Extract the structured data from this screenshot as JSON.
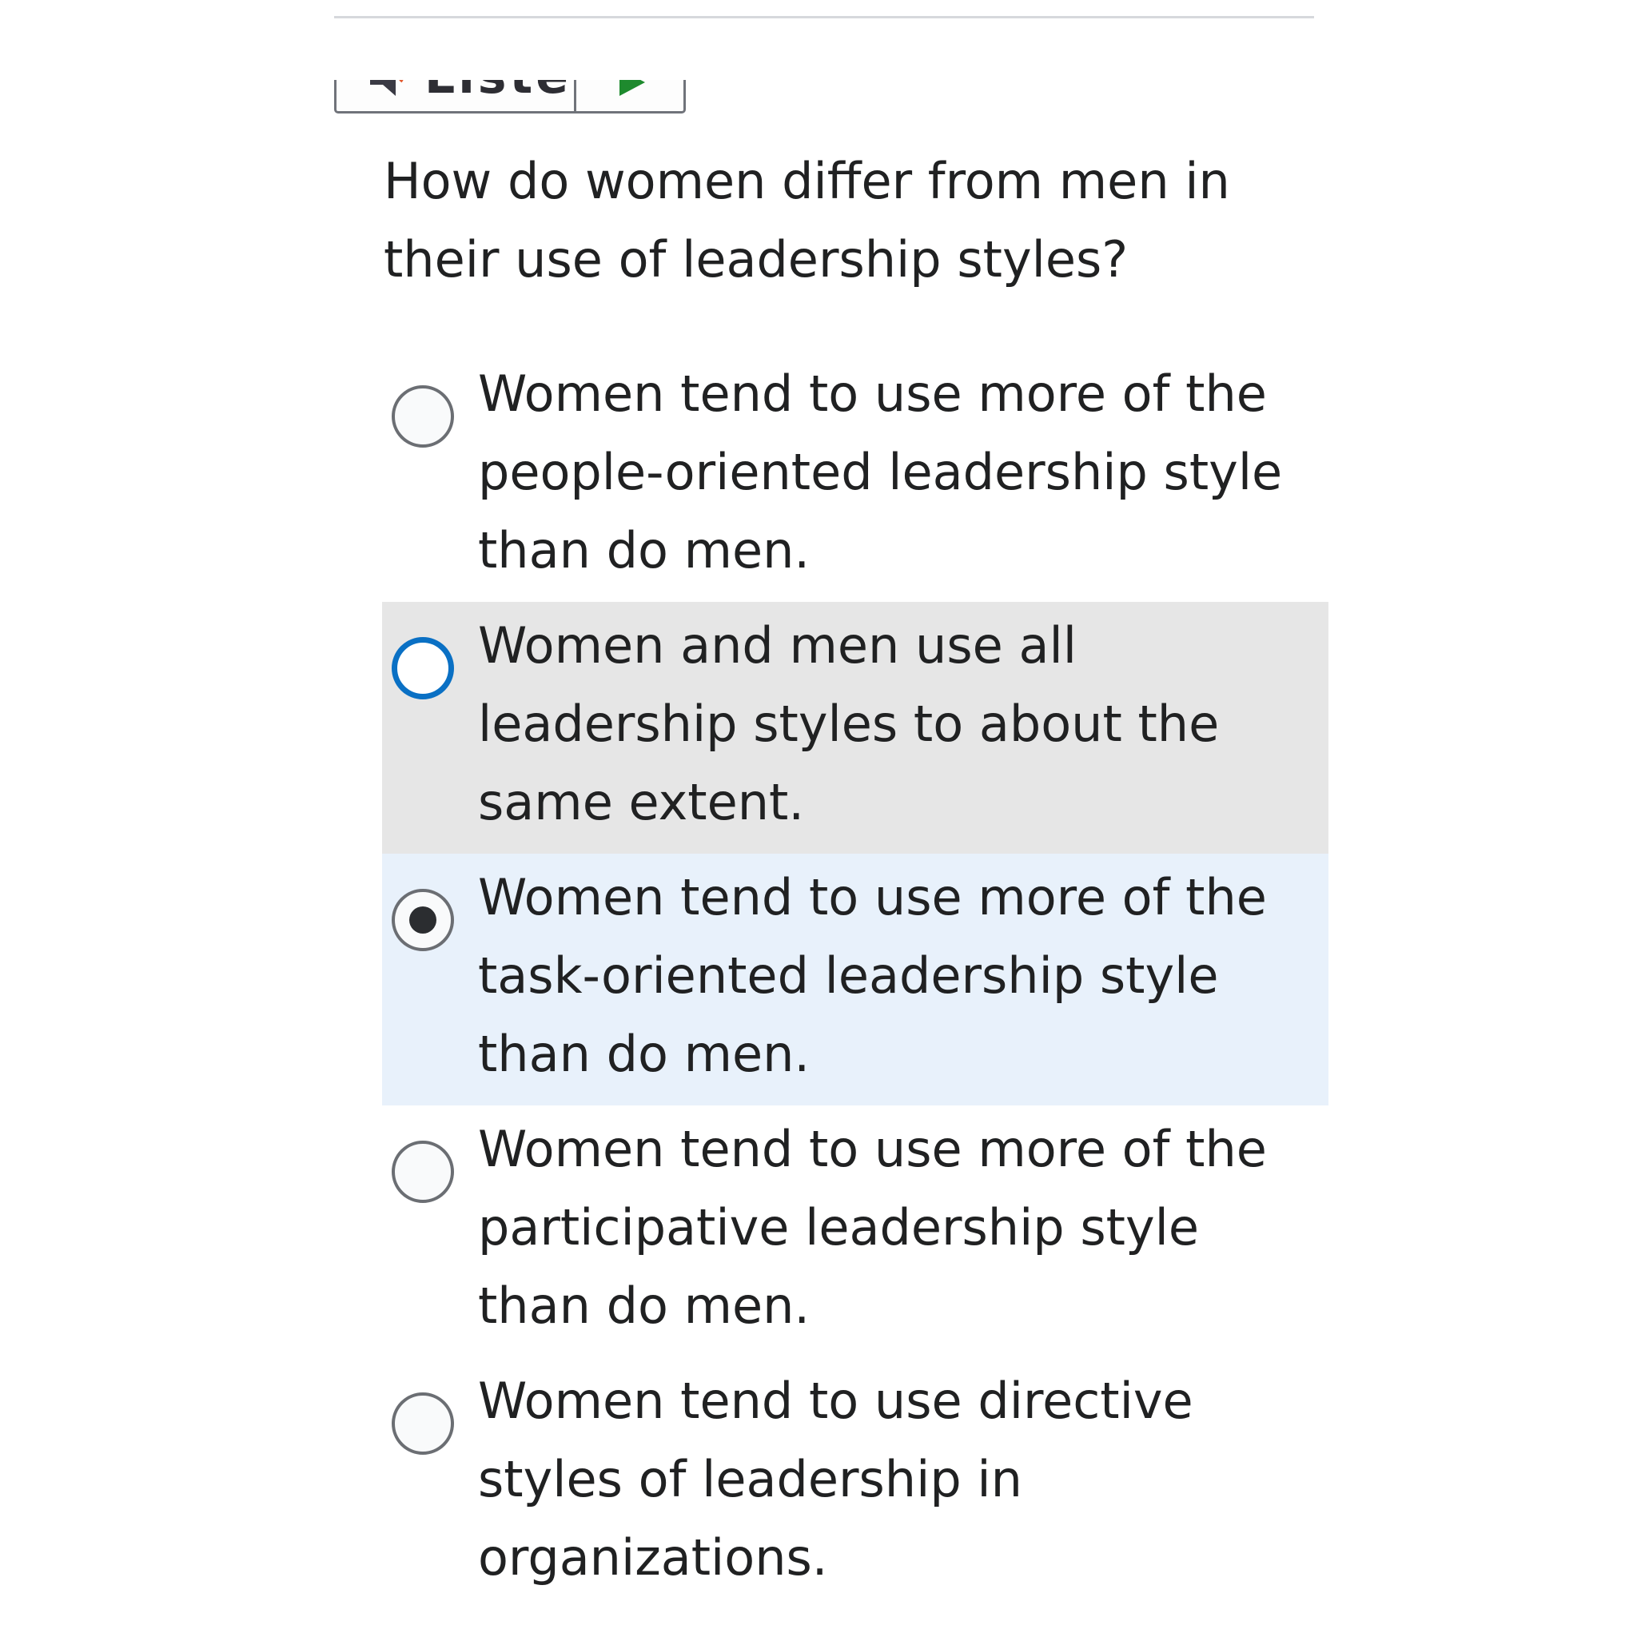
{
  "toolbar": {
    "listen_label": "Listen",
    "speaker_icon": "speaker-icon",
    "play_icon": "play-icon",
    "play_color": "#1e8a2e"
  },
  "question": {
    "text": "How do women differ from men in their use of leadership styles?"
  },
  "options": [
    {
      "label": "Women tend to use more of the people-oriented leadership style than do men.",
      "selected": false,
      "state": "default"
    },
    {
      "label": "Women and men use all leadership styles to about the same extent.",
      "selected": false,
      "state": "hover-focus"
    },
    {
      "label": "Women tend to use more of the task-oriented leadership style than do men.",
      "selected": true,
      "state": "selected"
    },
    {
      "label": "Women tend to use more of the participative leadership style than do men.",
      "selected": false,
      "state": "default"
    },
    {
      "label": "Women tend to use directive styles of leadership in organizations.",
      "selected": false,
      "state": "default"
    }
  ],
  "colors": {
    "hover_bg": "#e6e6e6",
    "selected_bg": "#e8f1fb",
    "focus_ring": "#0a70c4"
  }
}
